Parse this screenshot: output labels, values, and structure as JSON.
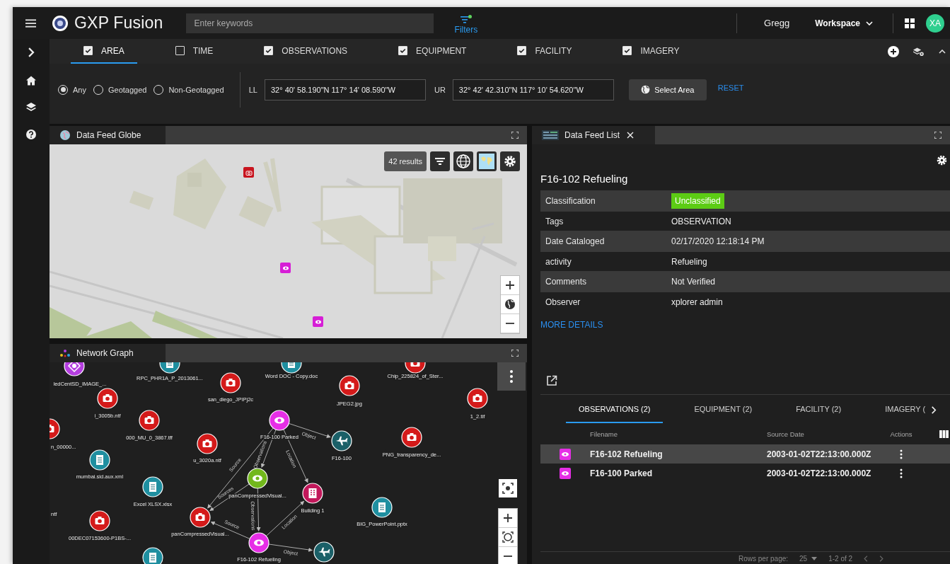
{
  "app": {
    "title": "GXP Fusion"
  },
  "search": {
    "placeholder": "Enter keywords"
  },
  "filters_button": {
    "label": "Filters"
  },
  "user": {
    "name": "Gregg",
    "initials": "XA"
  },
  "workspace_menu": {
    "label": "Workspace"
  },
  "filter_tabs": [
    {
      "label": "AREA",
      "checked": true,
      "selected": true
    },
    {
      "label": "TIME",
      "checked": false,
      "selected": false
    },
    {
      "label": "OBSERVATIONS",
      "checked": true,
      "selected": false
    },
    {
      "label": "EQUIPMENT",
      "checked": true,
      "selected": false
    },
    {
      "label": "FACILITY",
      "checked": true,
      "selected": false
    },
    {
      "label": "IMAGERY",
      "checked": true,
      "selected": false
    }
  ],
  "area": {
    "location_options": [
      {
        "label": "Any",
        "selected": true
      },
      {
        "label": "Geotagged",
        "selected": false
      },
      {
        "label": "Non-Geotagged",
        "selected": false
      }
    ],
    "lower_left": {
      "label": "LL",
      "value": "32° 40' 58.190\"N 117° 14' 08.590\"W"
    },
    "upper_right": {
      "label": "UR",
      "value": "32° 42' 42.310\"N 117° 10' 54.620\"W"
    },
    "select_area_button": "Select Area",
    "reset_link": "RESET"
  },
  "globe_panel": {
    "title": "Data Feed Globe",
    "results": "42 results",
    "pins": [
      {
        "kind": "camera"
      },
      {
        "kind": "observation"
      },
      {
        "kind": "observation"
      }
    ]
  },
  "graph_panel": {
    "title": "Network Graph",
    "nodes": [
      {
        "label": "ledCentSD_IMAGE_...",
        "kind": "target",
        "color": "#b53fe0"
      },
      {
        "label": "RPC_PHR1A_P_2013061...",
        "kind": "document",
        "color": "#1f8fa0"
      },
      {
        "label": "san_diego_JPIPj2c",
        "kind": "camera",
        "color": "#d41a1a"
      },
      {
        "label": "Word DOC - Copy.doc",
        "kind": "document",
        "color": "#1f8fa0"
      },
      {
        "label": "Chip_225824_of_Ster...",
        "kind": "camera",
        "color": "#d41a1a"
      },
      {
        "label": "JPEG2.jpg",
        "kind": "camera",
        "color": "#d41a1a"
      },
      {
        "label": "i_3005b.ntf",
        "kind": "camera",
        "color": "#d41a1a"
      },
      {
        "label": "1_2.tif",
        "kind": "camera",
        "color": "#d41a1a"
      },
      {
        "label": "n_00000...",
        "kind": "camera",
        "color": "#d41a1a"
      },
      {
        "label": "000_MU_0_3867.tff",
        "kind": "camera",
        "color": "#d41a1a"
      },
      {
        "label": "F16-100 Parked",
        "kind": "observation",
        "color": "#e62ee6"
      },
      {
        "label": "F16-100",
        "kind": "aircraft",
        "color": "#1b6068"
      },
      {
        "label": "u_3020a.ntf",
        "kind": "camera",
        "color": "#d41a1a"
      },
      {
        "label": "PNG_transparency_de...",
        "kind": "camera",
        "color": "#d41a1a"
      },
      {
        "label": "mumbai.sid.aux.xml",
        "kind": "document",
        "color": "#1f8fa0"
      },
      {
        "label": "panCompressedVisual...",
        "kind": "observation",
        "color": "#72b81c"
      },
      {
        "label": "Building 1",
        "kind": "building",
        "color": "#c2185b"
      },
      {
        "label": "Excel XLSX.xlsx",
        "kind": "document",
        "color": "#1f8fa0"
      },
      {
        "label": "BIG_PowerPoint.pptx",
        "kind": "document",
        "color": "#1f8fa0"
      },
      {
        "label": "panCompressedVisual...",
        "kind": "camera",
        "color": "#d41a1a"
      },
      {
        "label": "00DEC07153600-P1BS-...",
        "kind": "camera",
        "color": "#d41a1a"
      },
      {
        "label": "ntf"
      },
      {
        "label": "F16-102 Refueling",
        "kind": "observation",
        "color": "#e62ee6"
      },
      {
        "kind": "aircraft",
        "color": "#1b6068"
      },
      {
        "kind": "document",
        "color": "#1f8fa0"
      }
    ],
    "edges": [
      {
        "label": "Object"
      },
      {
        "label": "Observations"
      },
      {
        "label": "Location"
      },
      {
        "label": "Source"
      },
      {
        "label": "Sources"
      },
      {
        "label": "Observations"
      },
      {
        "label": "Source"
      },
      {
        "label": "Location"
      },
      {
        "label": "Object"
      }
    ]
  },
  "detail_panel": {
    "tab": "Data Feed List",
    "heading": "F16-102 Refueling",
    "properties": [
      {
        "name": "Classification",
        "value": "Unclassified",
        "kind": "badge"
      },
      {
        "name": "Tags",
        "value": "OBSERVATION",
        "kind": "text"
      },
      {
        "name": "Date Cataloged",
        "value": "02/17/2020 12:18:14 PM",
        "kind": "text"
      },
      {
        "name": "activity",
        "value": "Refueling",
        "kind": "text"
      },
      {
        "name": "Comments",
        "value": "Not Verified",
        "kind": "text"
      },
      {
        "name": "Observer",
        "value": "xplorer admin",
        "kind": "text"
      }
    ],
    "more_link": "MORE DETAILS",
    "related_tabs": [
      {
        "label": "OBSERVATIONS (2)",
        "selected": true
      },
      {
        "label": "EQUIPMENT (2)",
        "selected": false
      },
      {
        "label": "FACILITY (2)",
        "selected": false
      },
      {
        "label": "IMAGERY (",
        "selected": false
      }
    ],
    "columns": [
      "Filename",
      "Source Date",
      "Actions"
    ],
    "rows": [
      {
        "filename": "F16-102 Refueling",
        "source_date": "2003-01-02T22:13:00.000Z",
        "selected": true
      },
      {
        "filename": "F16-100 Parked",
        "source_date": "2003-01-02T22:13:00.000Z",
        "selected": false
      }
    ],
    "pager": {
      "rows_per_page_label": "Rows per page:",
      "rows_per_page": "25",
      "range": "1-2 of 2"
    }
  }
}
